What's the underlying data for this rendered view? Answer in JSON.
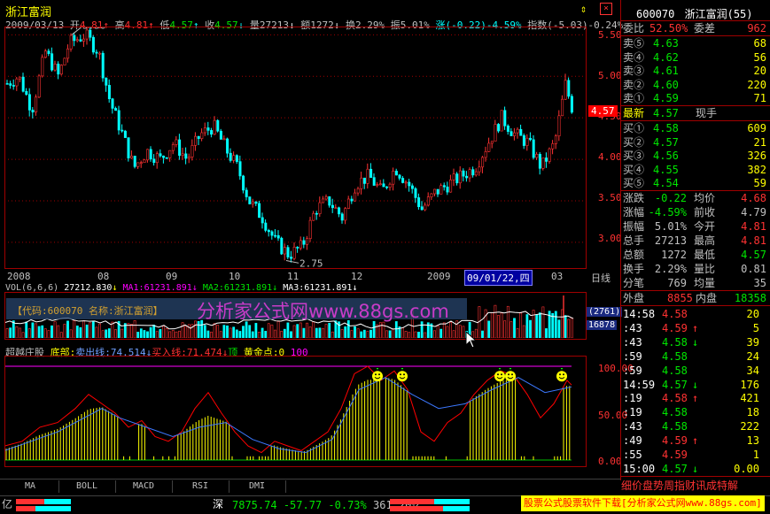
{
  "stock_title": "浙江富润",
  "header": {
    "date": "2009/03/13",
    "open_label": "开",
    "open": "4.81",
    "high_label": "高",
    "high": "4.81",
    "low_label": "低",
    "low": "4.57",
    "close_label": "收",
    "close": "4.57",
    "vol_label": "量",
    "vol": "27213",
    "amt_label": "额",
    "amt": "1272",
    "turn_label": "换",
    "turn": "2.29%",
    "amp_label": "振",
    "amp": "5.01%",
    "chg_label": "涨",
    "chg": "(-0.22)-4.59%",
    "idx_label": "指数",
    "idx": "(-5.03)-0.24%"
  },
  "price_axis": [
    "5.50",
    "5.00",
    "4.50",
    "4.00",
    "3.50",
    "3.00"
  ],
  "price_marker": "4.57",
  "peak_label": "5.50",
  "trough_label": "2.75",
  "time_axis": [
    "2008",
    "08",
    "09",
    "10",
    "11",
    "12",
    "2009",
    "09/01/22,四",
    "03"
  ],
  "day_line_label": "日线",
  "vol_header": {
    "label": "VOL(6,6,6)",
    "value": "27212.830",
    "ma1": "MA1:61231.891",
    "ma2": "MA2:61231.891",
    "ma3": "MA3:61231.891"
  },
  "vol_axis": [
    "(2761)",
    "16878"
  ],
  "watermark": {
    "code_label": "【代码:600070",
    "name_label": "名称:浙江富润】",
    "site": "分析家公式网www.88gs.com"
  },
  "indicator_header": {
    "name": "超越庄股",
    "bottom": "底部:",
    "sell": "卖出线:74.514",
    "buy": "买入线:71.474",
    "top": "顶",
    "gold": "黄金点:0",
    "hundred": "100"
  },
  "ind_axis": [
    "100.00",
    "50.00",
    "0.00"
  ],
  "quote": {
    "code": "600070",
    "name": "浙江富润",
    "num": "(55)",
    "ratio_label": "委比",
    "ratio": "52.50%",
    "diff_label": "委差",
    "diff": "962",
    "sells": [
      {
        "label": "卖⑤",
        "price": "4.63",
        "vol": "68"
      },
      {
        "label": "卖④",
        "price": "4.62",
        "vol": "56"
      },
      {
        "label": "卖③",
        "price": "4.61",
        "vol": "20"
      },
      {
        "label": "卖②",
        "price": "4.60",
        "vol": "220"
      },
      {
        "label": "卖①",
        "price": "4.59",
        "vol": "71"
      }
    ],
    "last_label": "最新",
    "last": "4.57",
    "now_label": "现手",
    "buys": [
      {
        "label": "买①",
        "price": "4.58",
        "vol": "609"
      },
      {
        "label": "买②",
        "price": "4.57",
        "vol": "21"
      },
      {
        "label": "买③",
        "price": "4.56",
        "vol": "326"
      },
      {
        "label": "买④",
        "price": "4.55",
        "vol": "382"
      },
      {
        "label": "买⑤",
        "price": "4.54",
        "vol": "59"
      }
    ],
    "stats": [
      {
        "l1": "涨跌",
        "v1": "-0.22",
        "l2": "均价",
        "v2": "4.68",
        "c1": "grn",
        "c2": "red"
      },
      {
        "l1": "涨幅",
        "v1": "-4.59%",
        "l2": "前收",
        "v2": "4.79",
        "c1": "grn",
        "c2": "gry"
      },
      {
        "l1": "振幅",
        "v1": "5.01%",
        "l2": "今开",
        "v2": "4.81",
        "c1": "gry",
        "c2": "red"
      },
      {
        "l1": "总手",
        "v1": "27213",
        "l2": "最高",
        "v2": "4.81",
        "c1": "gry",
        "c2": "red"
      },
      {
        "l1": "总额",
        "v1": "1272",
        "l2": "最低",
        "v2": "4.57",
        "c1": "gry",
        "c2": "grn"
      },
      {
        "l1": "换手",
        "v1": "2.29%",
        "l2": "量比",
        "v2": "0.81",
        "c1": "gry",
        "c2": "gry"
      },
      {
        "l1": "分笔",
        "v1": "769",
        "l2": "均量",
        "v2": "35",
        "c1": "gry",
        "c2": "gry"
      }
    ],
    "outer_label": "外盘",
    "outer": "8855",
    "inner_label": "内盘",
    "inner": "18358"
  },
  "ticks": [
    {
      "t": "14:58",
      "p": "4.58",
      "a": "",
      "q": "20",
      "c": "red"
    },
    {
      "t": ":43",
      "p": "4.59",
      "a": "↑",
      "q": "5",
      "c": "red"
    },
    {
      "t": ":43",
      "p": "4.58",
      "a": "↓",
      "q": "39",
      "c": "grn"
    },
    {
      "t": ":59",
      "p": "4.58",
      "a": "",
      "q": "24",
      "c": "grn"
    },
    {
      "t": ":59",
      "p": "4.58",
      "a": "",
      "q": "34",
      "c": "grn"
    },
    {
      "t": "14:59",
      "p": "4.57",
      "a": "↓",
      "q": "176",
      "c": "grn"
    },
    {
      "t": ":19",
      "p": "4.58",
      "a": "↑",
      "q": "421",
      "c": "red"
    },
    {
      "t": ":19",
      "p": "4.58",
      "a": "",
      "q": "18",
      "c": "grn"
    },
    {
      "t": ":43",
      "p": "4.58",
      "a": "",
      "q": "222",
      "c": "grn"
    },
    {
      "t": ":49",
      "p": "4.59",
      "a": "↑",
      "q": "13",
      "c": "red"
    },
    {
      "t": ":55",
      "p": "4.59",
      "a": "",
      "q": "1",
      "c": "red"
    },
    {
      "t": "15:00",
      "p": "4.57",
      "a": "↓",
      "q": "0.00",
      "c": "grn"
    }
  ],
  "right_tabs": "细价盘势周指财讯成特解",
  "bottom_tabs": [
    "MA",
    "BOLL",
    "MACD",
    "RSI",
    "DMI"
  ],
  "status": {
    "yi1": "亿",
    "market": "深",
    "index": "7875.74",
    "chg": "-57.77",
    "pct": "-0.73%",
    "amt": "361.20亿",
    "ad": "股票公式股票软件下载[分析家公式网www.88gs.com]"
  }
}
